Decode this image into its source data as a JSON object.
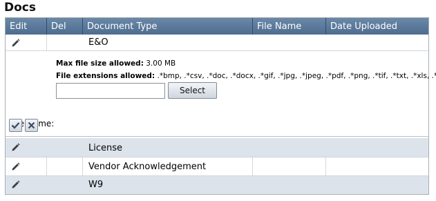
{
  "section": {
    "title": "Docs"
  },
  "table": {
    "headers": {
      "edit": "Edit",
      "del": "Del",
      "doc_type": "Document Type",
      "file_name": "File Name",
      "date_uploaded": "Date Uploaded"
    },
    "rows": [
      {
        "doc_type": "E&O"
      },
      {
        "doc_type": "License"
      },
      {
        "doc_type": "Vendor Acknowledgement"
      },
      {
        "doc_type": "W9"
      }
    ]
  },
  "upload": {
    "max_size_label": "Max file size allowed:",
    "max_size_value": "3.00 MB",
    "ext_label": "File extensions allowed:",
    "ext_value": ".*bmp, .*csv, .*doc, .*docx, .*gif, .*jpg, .*jpeg, .*pdf, .*png, .*tif, .*txt, .*xls, .*xlsx",
    "file_name_label": "File Name:",
    "file_name_value": "",
    "select_label": "Select"
  },
  "icons": {
    "edit": "pencil-icon",
    "save": "checkmark-icon",
    "cancel": "x-icon"
  },
  "colors": {
    "header_bg": "#5a7899",
    "alt_row_bg": "#dde3ea"
  }
}
